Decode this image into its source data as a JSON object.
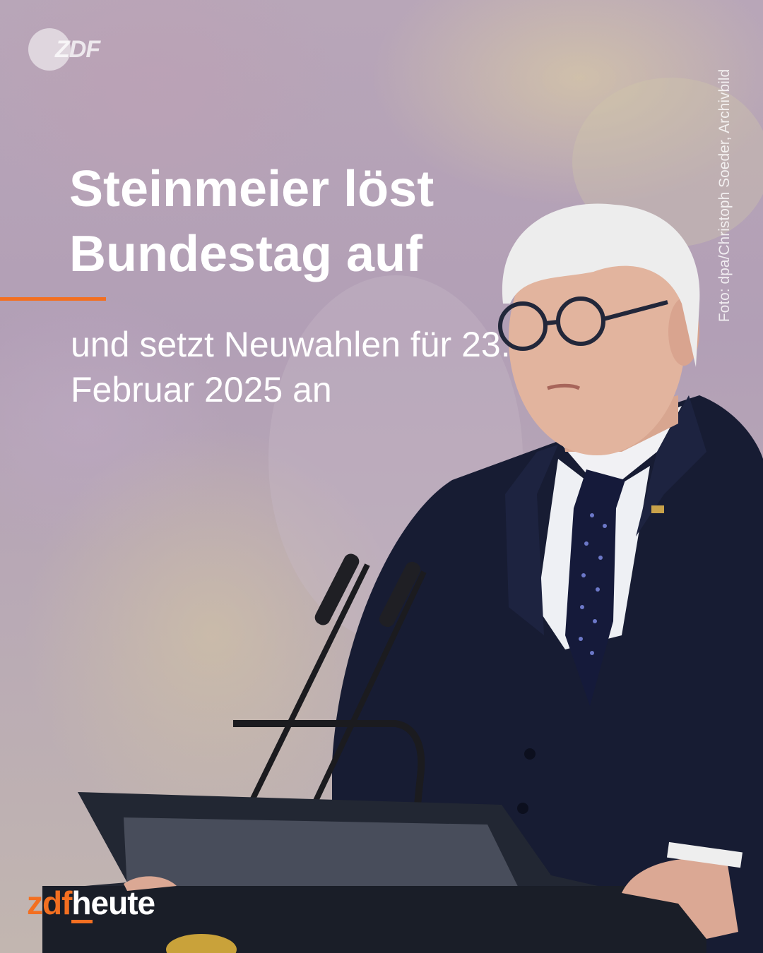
{
  "colors": {
    "accent": "#f36f21",
    "text": "#ffffff",
    "suit": "#171c33"
  },
  "logo": {
    "zdf_badge": "ZDF",
    "brand_part1": "zdf",
    "brand_part2": "heute"
  },
  "headline": "Steinmeier löst Bundestag auf",
  "subline": "und setzt Neuwahlen für 23. Februar 2025 an",
  "photo_credit": "Foto: dpa/Christoph Soeder, Archivbild"
}
